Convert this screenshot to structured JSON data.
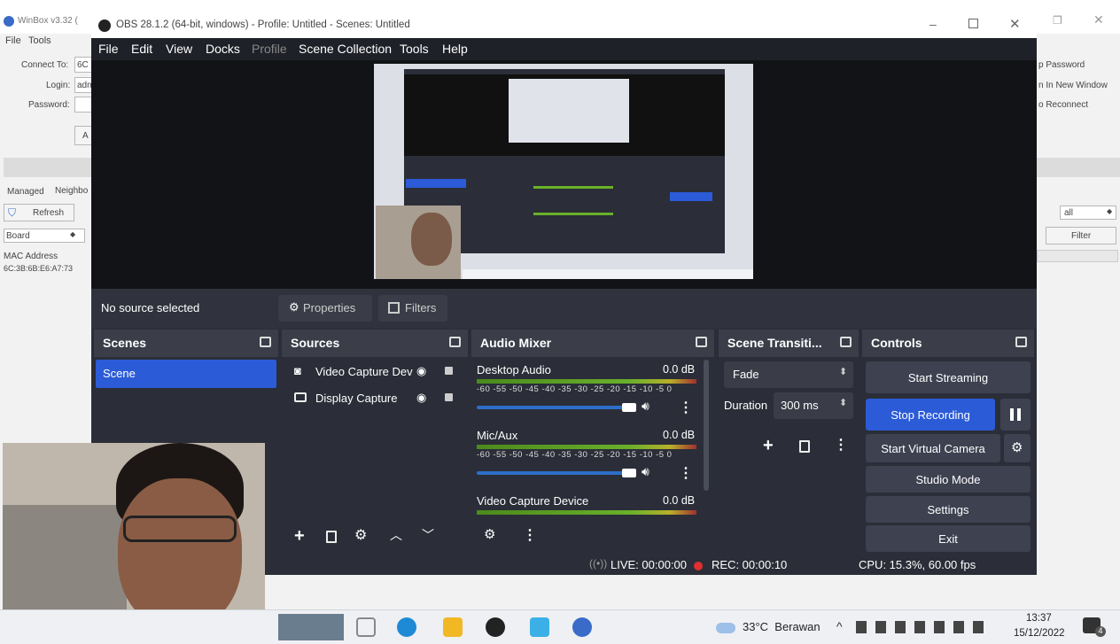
{
  "winbox": {
    "title": "WinBox v3.32 (",
    "menu": [
      "File",
      "Tools"
    ],
    "connect_to_label": "Connect To:",
    "connect_to_value": "6C",
    "login_label": "Login:",
    "login_value": "adm",
    "password_label": "Password:",
    "keep_password": "p Password",
    "open_new_window": "n In New Window",
    "auto_reconnect": "o Reconnect",
    "add_btn": "A",
    "tab_managed": "Managed",
    "tab_neighbors": "Neighbo",
    "refresh": "Refresh",
    "board_label": "Board",
    "filter_value": "all",
    "filter_btn": "Filter",
    "col_mac": "MAC Address",
    "mac_value": "6C:3B:6B:E6:A7:73"
  },
  "obs": {
    "title": "OBS 28.1.2 (64-bit, windows) - Profile: Untitled - Scenes: Untitled",
    "menu": [
      "File",
      "Edit",
      "View",
      "Docks",
      "Profile",
      "Scene Collection",
      "Tools",
      "Help"
    ],
    "no_source": "No source selected",
    "properties_btn": "Properties",
    "filters_btn": "Filters",
    "scenes": {
      "title": "Scenes",
      "items": [
        "Scene"
      ]
    },
    "sources": {
      "title": "Sources",
      "items": [
        "Video Capture Dev",
        "Display Capture"
      ]
    },
    "audio": {
      "title": "Audio Mixer",
      "channels": [
        {
          "name": "Desktop Audio",
          "db": "0.0 dB"
        },
        {
          "name": "Mic/Aux",
          "db": "0.0 dB"
        },
        {
          "name": "Video Capture Device",
          "db": "0.0 dB"
        }
      ],
      "ticks": "-60 -55 -50 -45 -40 -35 -30 -25 -20 -15 -10 -5 0"
    },
    "transitions": {
      "title": "Scene Transiti...",
      "transition": "Fade",
      "duration_label": "Duration",
      "duration_value": "300 ms"
    },
    "controls": {
      "title": "Controls",
      "start_streaming": "Start Streaming",
      "stop_recording": "Stop Recording",
      "start_virtual_camera": "Start Virtual Camera",
      "studio_mode": "Studio Mode",
      "settings": "Settings",
      "exit": "Exit"
    },
    "status": {
      "live": "LIVE: 00:00:00",
      "rec": "REC: 00:00:10",
      "cpu": "CPU: 15.3%, 60.00 fps"
    },
    "colors": {
      "accent": "#2b5bd7",
      "bg": "#2b2e38",
      "header": "#3b3e49"
    }
  },
  "taskbar": {
    "weather": "33°C  Berawan",
    "time": "13:37",
    "date": "15/12/2022",
    "notifications": "4"
  }
}
